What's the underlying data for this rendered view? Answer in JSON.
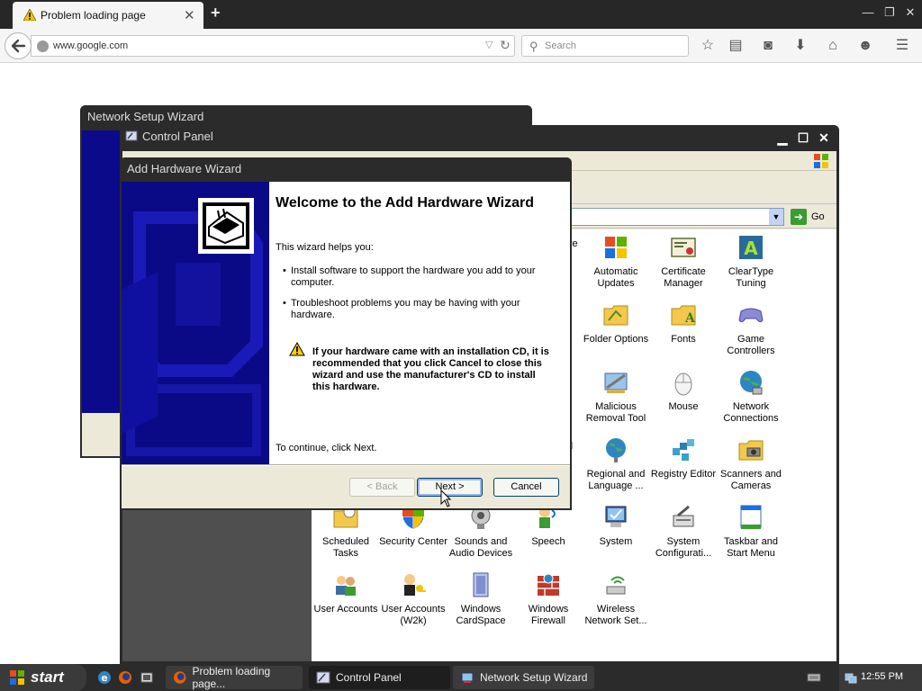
{
  "browser": {
    "tab_title": "Problem loading page",
    "url": "www.google.com",
    "search_placeholder": "Search"
  },
  "network_wizard": {
    "title": "Network Setup Wizard"
  },
  "control_panel": {
    "title": "Control Panel",
    "go_label": "Go",
    "items": [
      {
        "label": "Automatic Updates",
        "icon": "automatic-updates-icon"
      },
      {
        "label": "Certificate Manager",
        "icon": "certificate-manager-icon"
      },
      {
        "label": "ClearType Tuning",
        "icon": "cleartype-tuning-icon"
      },
      {
        "label": "Folder Options",
        "icon": "folder-options-icon"
      },
      {
        "label": "Fonts",
        "icon": "fonts-icon"
      },
      {
        "label": "Game Controllers",
        "icon": "game-controllers-icon"
      },
      {
        "label": "Malicious Removal Tool",
        "icon": "malicious-removal-tool-icon"
      },
      {
        "label": "Mouse",
        "icon": "mouse-icon"
      },
      {
        "label": "Network Connections",
        "icon": "network-connections-icon"
      },
      {
        "label": "Regional and Language ...",
        "icon": "regional-language-icon"
      },
      {
        "label": "Registry Editor",
        "icon": "registry-editor-icon"
      },
      {
        "label": "Scanners and Cameras",
        "icon": "scanners-cameras-icon"
      },
      {
        "label": "Scheduled Tasks",
        "icon": "scheduled-tasks-icon"
      },
      {
        "label": "Security Center",
        "icon": "security-center-icon"
      },
      {
        "label": "Sounds and Audio Devices",
        "icon": "sounds-audio-icon"
      },
      {
        "label": "Speech",
        "icon": "speech-icon"
      },
      {
        "label": "System",
        "icon": "system-icon"
      },
      {
        "label": "System Configurati...",
        "icon": "system-configuration-icon"
      },
      {
        "label": "Taskbar and Start Menu",
        "icon": "taskbar-start-menu-icon"
      },
      {
        "label": "User Accounts",
        "icon": "user-accounts-icon"
      },
      {
        "label": "User Accounts (W2k)",
        "icon": "user-accounts-w2k-icon"
      },
      {
        "label": "Windows CardSpace",
        "icon": "windows-cardspace-icon"
      },
      {
        "label": "Windows Firewall",
        "icon": "windows-firewall-icon"
      },
      {
        "label": "Wireless Network Set...",
        "icon": "wireless-network-icon"
      }
    ],
    "partial_labels": {
      "row1": "ve",
      "row2": "r",
      "row4": "d"
    }
  },
  "wizard": {
    "title": "Add Hardware Wizard",
    "heading": "Welcome to the Add Hardware Wizard",
    "intro": "This wizard helps you:",
    "bullets": [
      "Install software to support the hardware you add to your computer.",
      "Troubleshoot problems you may be having with your hardware."
    ],
    "warning": "If your hardware came with an installation CD, it is recommended that you click Cancel to close this wizard and use the manufacturer's CD to install this hardware.",
    "continue_text": "To continue, click Next.",
    "back_label": "< Back",
    "next_label": "Next >",
    "cancel_label": "Cancel"
  },
  "taskbar": {
    "start_label": "start",
    "tasks": [
      {
        "label": "Problem loading page..."
      },
      {
        "label": "Control Panel"
      },
      {
        "label": "Network Setup Wizard"
      }
    ],
    "clock": "12:55 PM"
  },
  "colors": {
    "xp_title_dark": "#2b2b2b",
    "wizard_side_blue": "#0a0a86",
    "go_green": "#3a9c33"
  }
}
